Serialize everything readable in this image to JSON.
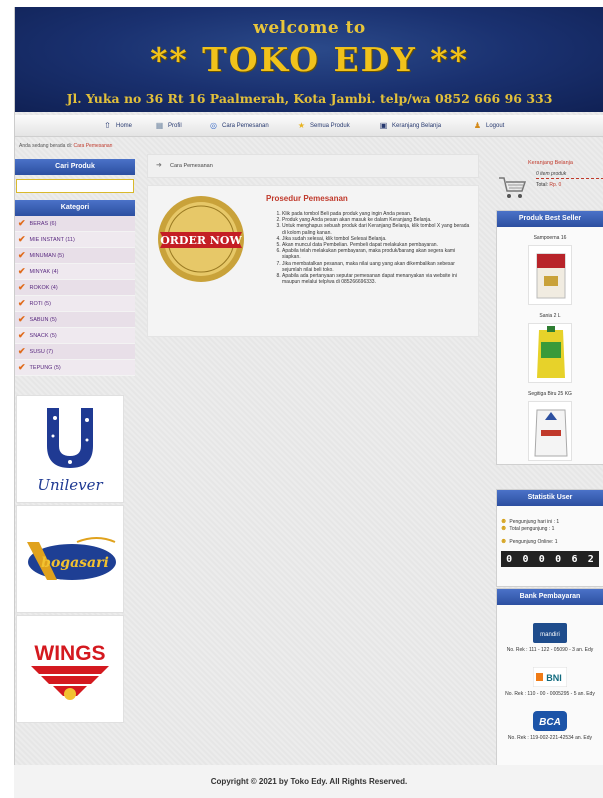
{
  "header": {
    "welcome": "welcome to",
    "shop_name": "** TOKO EDY **",
    "address": "Jl. Yuka no 36 Rt 16 Paalmerah, Kota Jambi. telp/wa 0852 666 96 333"
  },
  "nav": [
    {
      "label": "Home",
      "icon": "home-icon"
    },
    {
      "label": "Profil",
      "icon": "profile-icon"
    },
    {
      "label": "Cara Pemesanan",
      "icon": "info-icon"
    },
    {
      "label": "Semua Produk",
      "icon": "star-icon"
    },
    {
      "label": "Keranjang Belanja",
      "icon": "cart-icon"
    },
    {
      "label": "Logout",
      "icon": "logout-icon"
    }
  ],
  "breadcrumb": {
    "prefix": "Anda sedang berada di:",
    "current": "Cara Pemesanan"
  },
  "search": {
    "title": "Cari Produk",
    "placeholder": ""
  },
  "kategori": {
    "title": "Kategori",
    "items": [
      "BERAS (6)",
      "MIE INSTANT (11)",
      "MINUMAN (5)",
      "MINYAK (4)",
      "ROKOK (4)",
      "ROTI (5)",
      "SABUN (5)",
      "SNACK (5)",
      "SUSU (7)",
      "TEPUNG (5)"
    ]
  },
  "brands": [
    "Unilever",
    "bogasari",
    "WINGS"
  ],
  "center": {
    "breadcrumb": "Cara Pemesanan",
    "title": "Prosedur Pemesanan",
    "badge_text": "ORDER NOW",
    "steps": [
      "Klik pada tombol Beli pada produk yang ingin Anda pesan.",
      "Produk yang Anda pesan akan masuk ke dalam Keranjang Belanja.",
      "Untuk menghapus sebuah produk dari Keranjang Belanja, klik tombol X yang berada di kolom paling kanan.",
      "Jika sudah selesai, klik tombol Selesai Belanja.",
      "Akan muncul data Pembelian. Pembeli dapat melakukan pembayaran.",
      "Apabila telah melakukan pembayaran, maka produk/barang akan segera kami siapkan.",
      "Jika membatalkan pesanan, maka nilai uang yang akan dikembalikan sebesar sejumlah nilai beli toko.",
      "Apabila ada pertanyaan seputar pemesanan dapat menanyakan via website ini maupun melalui telp/wa di 085266696333."
    ]
  },
  "cart": {
    "title": "Keranjang Belanja",
    "items": "0 item produk",
    "total_label": "Total:",
    "total_value": "Rp. 0"
  },
  "best_seller": {
    "title": "Produk Best Seller",
    "items": [
      "Sampoerna 16",
      "Sania 2 L",
      "Segitiga Biru 25 KG"
    ]
  },
  "stats": {
    "title": "Statistik User",
    "today": "Pengunjung hari ini : 1",
    "total": "Total pengunjung : 1",
    "online": "Pengunjung Online: 1",
    "counter": [
      "0",
      "0",
      "0",
      "0",
      "6",
      "2"
    ]
  },
  "bank": {
    "title": "Bank Pembayaran",
    "items": [
      {
        "name": "mandiri",
        "detail": "No. Rek : 111 - 122 - 05090 - 3 an. Edy"
      },
      {
        "name": "BNI",
        "detail": "No. Rek : 110 - 00 - 0005295 - 5 an. Edy"
      },
      {
        "name": "BCA",
        "detail": "No. Rek : 119-002-221-42534 an. Edy"
      }
    ]
  },
  "footer": "Copyright © 2021 by Toko Edy. All Rights Reserved.",
  "colors": {
    "header_bg": "#1a3170",
    "gold": "#f1c21b",
    "panel_blue": "#2c4fa0",
    "accent_red": "#c0392b"
  }
}
